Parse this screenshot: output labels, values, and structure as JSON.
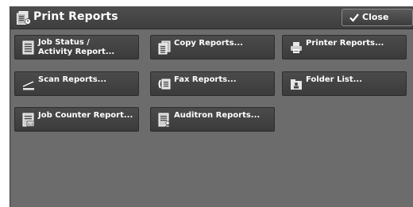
{
  "header": {
    "title": "Print Reports",
    "title_icon": "print-reports-icon",
    "close_label": "Close",
    "close_icon": "checkmark-icon"
  },
  "buttons": [
    {
      "label_line1": "Job Status /",
      "label_line2": "Activity Report...",
      "icon": "job-status-icon"
    },
    {
      "label": "Copy Reports...",
      "icon": "copy-reports-icon"
    },
    {
      "label": "Printer Reports...",
      "icon": "printer-icon"
    },
    {
      "label": "Scan Reports...",
      "icon": "scan-icon"
    },
    {
      "label": "Fax Reports...",
      "icon": "fax-icon"
    },
    {
      "label": "Folder List...",
      "icon": "folder-icon"
    },
    {
      "label": "Job Counter Report...",
      "icon": "job-counter-icon"
    },
    {
      "label": "Auditron Reports...",
      "icon": "auditron-icon"
    }
  ],
  "colors": {
    "panel": "#6c6c6c",
    "button": "#444444",
    "text": "#ffffff"
  }
}
